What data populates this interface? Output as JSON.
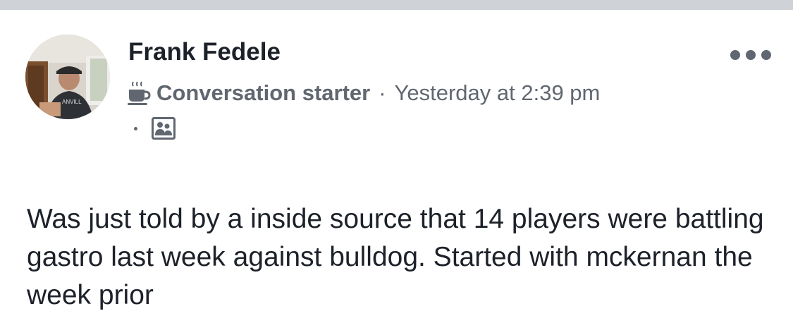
{
  "post": {
    "author_name": "Frank Fedele",
    "badge_label": "Conversation starter",
    "separator": "·",
    "timestamp": "Yesterday at 2:39 pm",
    "audience_icon": "group-icon",
    "badge_icon": "coffee-cup-icon",
    "more_icon": "more-options-icon",
    "text": "Was just told by a inside source that 14 players were battling gastro last week against bulldog. Started with mckernan the week prior"
  },
  "colors": {
    "name": "#1d2129",
    "meta": "#616770",
    "divider": "#cfd2d7"
  }
}
